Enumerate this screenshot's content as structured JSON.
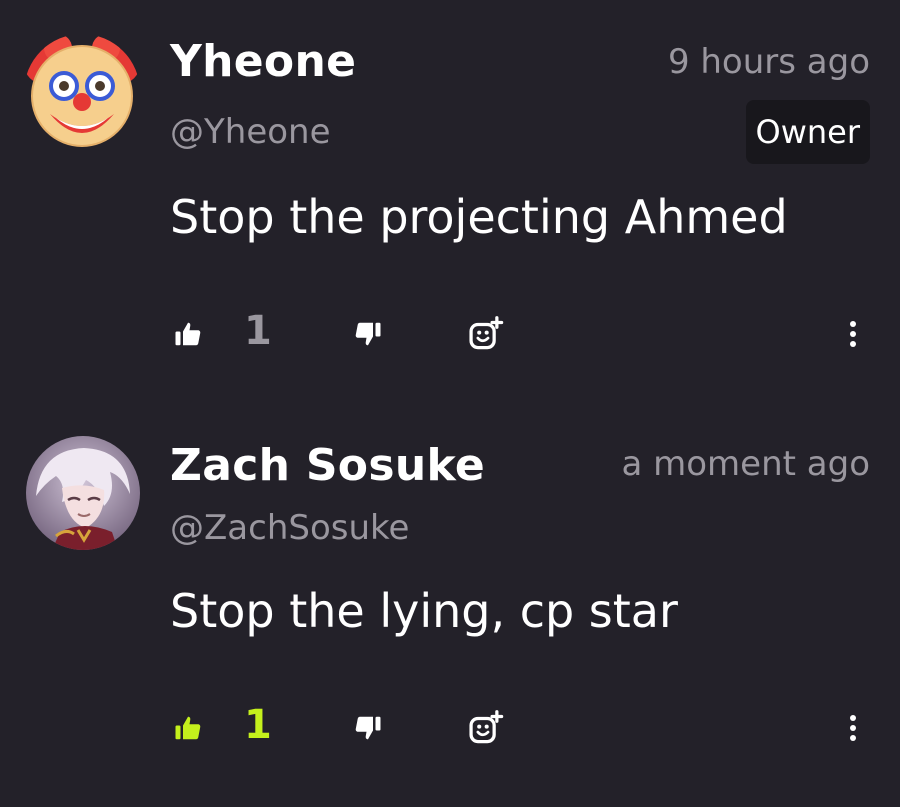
{
  "comments": [
    {
      "avatar_icon": "clown-face-icon",
      "name": "Yheone",
      "handle": "@Yheone",
      "time": "9 hours ago",
      "badge": "Owner",
      "text": "Stop the projecting Ahmed",
      "likes": "1",
      "liked": false,
      "colors": {
        "like": "#ffffff",
        "count": "#9a979f"
      }
    },
    {
      "avatar_icon": "anime-character-avatar",
      "name": "Zach Sosuke",
      "handle": "@ZachSosuke",
      "time": "a moment ago",
      "text": "Stop the lying, cp star",
      "likes": "1",
      "liked": true,
      "colors": {
        "like": "#c4f01c",
        "count": "#c4f01c"
      }
    }
  ],
  "theme": {
    "background": "#232129",
    "muted_text": "#9a979f",
    "accent": "#c4f01c",
    "badge_bg": "#18171c"
  }
}
